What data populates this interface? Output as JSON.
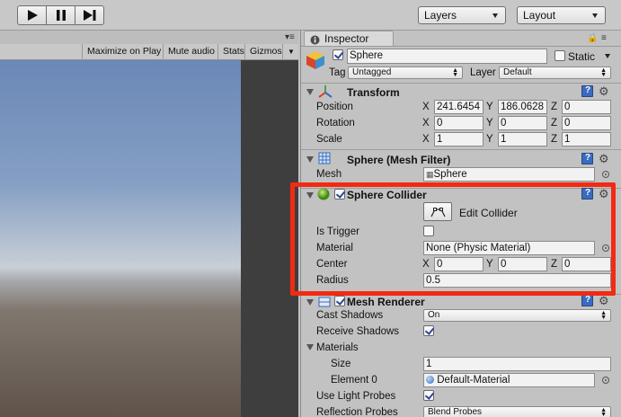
{
  "toolbar": {
    "layers_label": "Layers",
    "layout_label": "Layout"
  },
  "game_view": {
    "buttons": [
      "Maximize on Play",
      "Mute audio",
      "Stats",
      "Gizmos"
    ]
  },
  "inspector": {
    "tab_label": "Inspector",
    "object_name": "Sphere",
    "static_label": "Static",
    "tag_label": "Tag",
    "tag_value": "Untagged",
    "layer_label": "Layer",
    "layer_value": "Default",
    "transform": {
      "title": "Transform",
      "position_label": "Position",
      "rotation_label": "Rotation",
      "scale_label": "Scale",
      "position": [
        "241.6454",
        "186.0628",
        "0"
      ],
      "rotation": [
        "0",
        "0",
        "0"
      ],
      "scale": [
        "1",
        "1",
        "1"
      ]
    },
    "axis": [
      "X",
      "Y",
      "Z"
    ],
    "mesh_filter": {
      "title": "Sphere (Mesh Filter)",
      "mesh_label": "Mesh",
      "mesh_value": "Sphere"
    },
    "sphere_collider": {
      "title": "Sphere Collider",
      "edit_label": "Edit Collider",
      "is_trigger_label": "Is Trigger",
      "material_label": "Material",
      "material_value": "None (Physic Material)",
      "center_label": "Center",
      "center": [
        "0",
        "0",
        "0"
      ],
      "radius_label": "Radius",
      "radius_value": "0.5"
    },
    "mesh_renderer": {
      "title": "Mesh Renderer",
      "cast_shadows_label": "Cast Shadows",
      "cast_shadows_value": "On",
      "receive_shadows_label": "Receive Shadows",
      "materials_label": "Materials",
      "size_label": "Size",
      "size_value": "1",
      "element0_label": "Element 0",
      "element0_value": "Default-Material",
      "light_probes_label": "Use Light Probes",
      "reflection_label": "Reflection Probes",
      "reflection_value": "Blend Probes"
    }
  },
  "colors": {
    "highlight": "#f22a12",
    "panel": "#c2c2c2"
  }
}
